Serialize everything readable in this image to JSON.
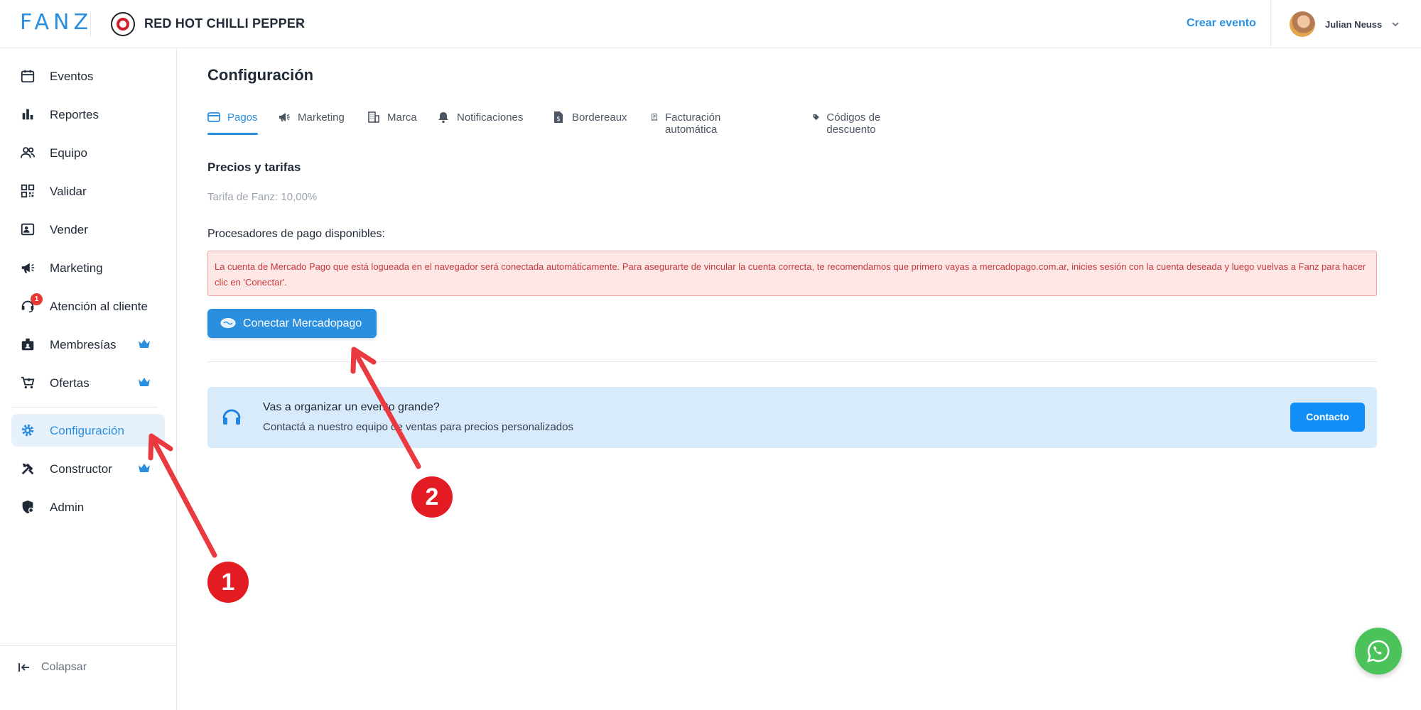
{
  "topbar": {
    "logo_text": "FANZ",
    "brand_name": "RED HOT CHILLI PEPPER",
    "create_event": "Crear evento",
    "user_name": "Julian Neuss"
  },
  "sidebar": {
    "items": [
      {
        "label": "Eventos",
        "icon": "calendar-icon"
      },
      {
        "label": "Reportes",
        "icon": "bar-chart-icon"
      },
      {
        "label": "Equipo",
        "icon": "people-icon"
      },
      {
        "label": "Validar",
        "icon": "qr-code-icon"
      },
      {
        "label": "Vender",
        "icon": "id-card-icon"
      },
      {
        "label": "Marketing",
        "icon": "megaphone-icon"
      },
      {
        "label": "Atención al cliente",
        "icon": "support-agent-icon",
        "badge": "1"
      },
      {
        "label": "Membresías",
        "icon": "badge-icon",
        "premium": true
      },
      {
        "label": "Ofertas",
        "icon": "cart-icon",
        "premium": true
      },
      {
        "label": "Configuración",
        "icon": "gear-icon",
        "active": true
      },
      {
        "label": "Constructor",
        "icon": "tools-icon",
        "premium": true
      },
      {
        "label": "Admin",
        "icon": "shield-icon"
      }
    ],
    "collapse_label": "Colapsar"
  },
  "main": {
    "title": "Configuración",
    "tabs": [
      {
        "label": "Pagos",
        "icon": "credit-card-icon",
        "active": true
      },
      {
        "label": "Marketing",
        "icon": "megaphone-icon"
      },
      {
        "label": "Marca",
        "icon": "building-icon"
      },
      {
        "label": "Notificaciones",
        "icon": "bell-icon"
      },
      {
        "label": "Bordereaux",
        "icon": "file-dollar-icon"
      },
      {
        "label": "Facturación automática",
        "icon": "receipt-icon"
      },
      {
        "label": "Códigos de descuento",
        "icon": "tag-icon"
      }
    ],
    "section_title": "Precios y tarifas",
    "fee_text": "Tarifa de Fanz: 10,00%",
    "processors_title": "Procesadores de pago disponibles:",
    "alert_text": "La cuenta de Mercado Pago que está logueada en el navegador será conectada automáticamente. Para asegurarte de vincular la cuenta correcta, te recomendamos que primero vayas a mercadopago.com.ar, inicies sesión con la cuenta deseada y luego vuelvas a Fanz para hacer clic en 'Conectar'.",
    "connect_button": "Conectar Mercadopago",
    "promo": {
      "title": "Vas a organizar un evento grande?",
      "subtitle": "Contactá a nuestro equipo de ventas para precios personalizados",
      "button": "Contacto"
    }
  },
  "annotations": {
    "marker_1": "1",
    "marker_2": "2",
    "color": "#e31b23"
  },
  "colors": {
    "accent": "#2b8fe0",
    "alert_bg": "#fde6e6",
    "alert_text": "#c93a3a",
    "promo_bg": "#d7ebfb",
    "whatsapp": "#4cc35a"
  }
}
